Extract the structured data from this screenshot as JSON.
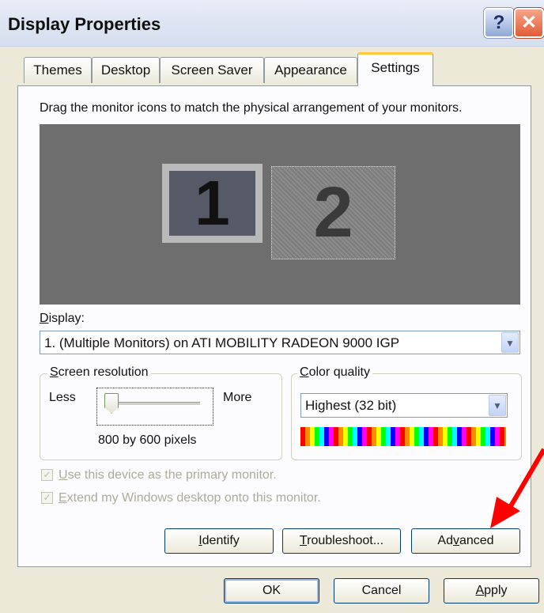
{
  "window": {
    "title": "Display Properties",
    "help_glyph": "?",
    "close_glyph": "✕"
  },
  "tabs": [
    {
      "label": "Themes"
    },
    {
      "label": "Desktop"
    },
    {
      "label": "Screen Saver"
    },
    {
      "label": "Appearance"
    },
    {
      "label": "Settings",
      "active": true
    }
  ],
  "settings": {
    "instruction": "Drag the monitor icons to match the physical arrangement of your monitors.",
    "monitors": [
      {
        "label": "1"
      },
      {
        "label": "2"
      }
    ],
    "display_label_u": "D",
    "display_label_rest": "isplay:",
    "display_value": "1. (Multiple Monitors) on ATI MOBILITY RADEON 9000 IGP",
    "resolution": {
      "legend_u": "S",
      "legend_rest": "creen resolution",
      "less": "Less",
      "more": "More",
      "value": "800 by 600 pixels",
      "slider_fraction": 0
    },
    "color_quality": {
      "legend_u": "C",
      "legend_rest": "olor quality",
      "value": "Highest (32 bit)"
    },
    "checkboxes": [
      {
        "u": "U",
        "rest": "se this device as the primary monitor.",
        "checked": true,
        "enabled": false
      },
      {
        "u": "E",
        "rest": "xtend my Windows desktop onto this monitor.",
        "checked": true,
        "enabled": false
      }
    ],
    "buttons": {
      "identify_u": "I",
      "identify_rest": "dentify",
      "troubleshoot_u": "T",
      "troubleshoot_rest": "roubleshoot...",
      "advanced_pre": "Ad",
      "advanced_u": "v",
      "advanced_rest": "anced"
    }
  },
  "dialog_buttons": {
    "ok": "OK",
    "cancel": "Cancel",
    "apply_u": "A",
    "apply_rest": "pply"
  },
  "annotation": {
    "color": "#ff0000",
    "points_to": "Advanced"
  }
}
